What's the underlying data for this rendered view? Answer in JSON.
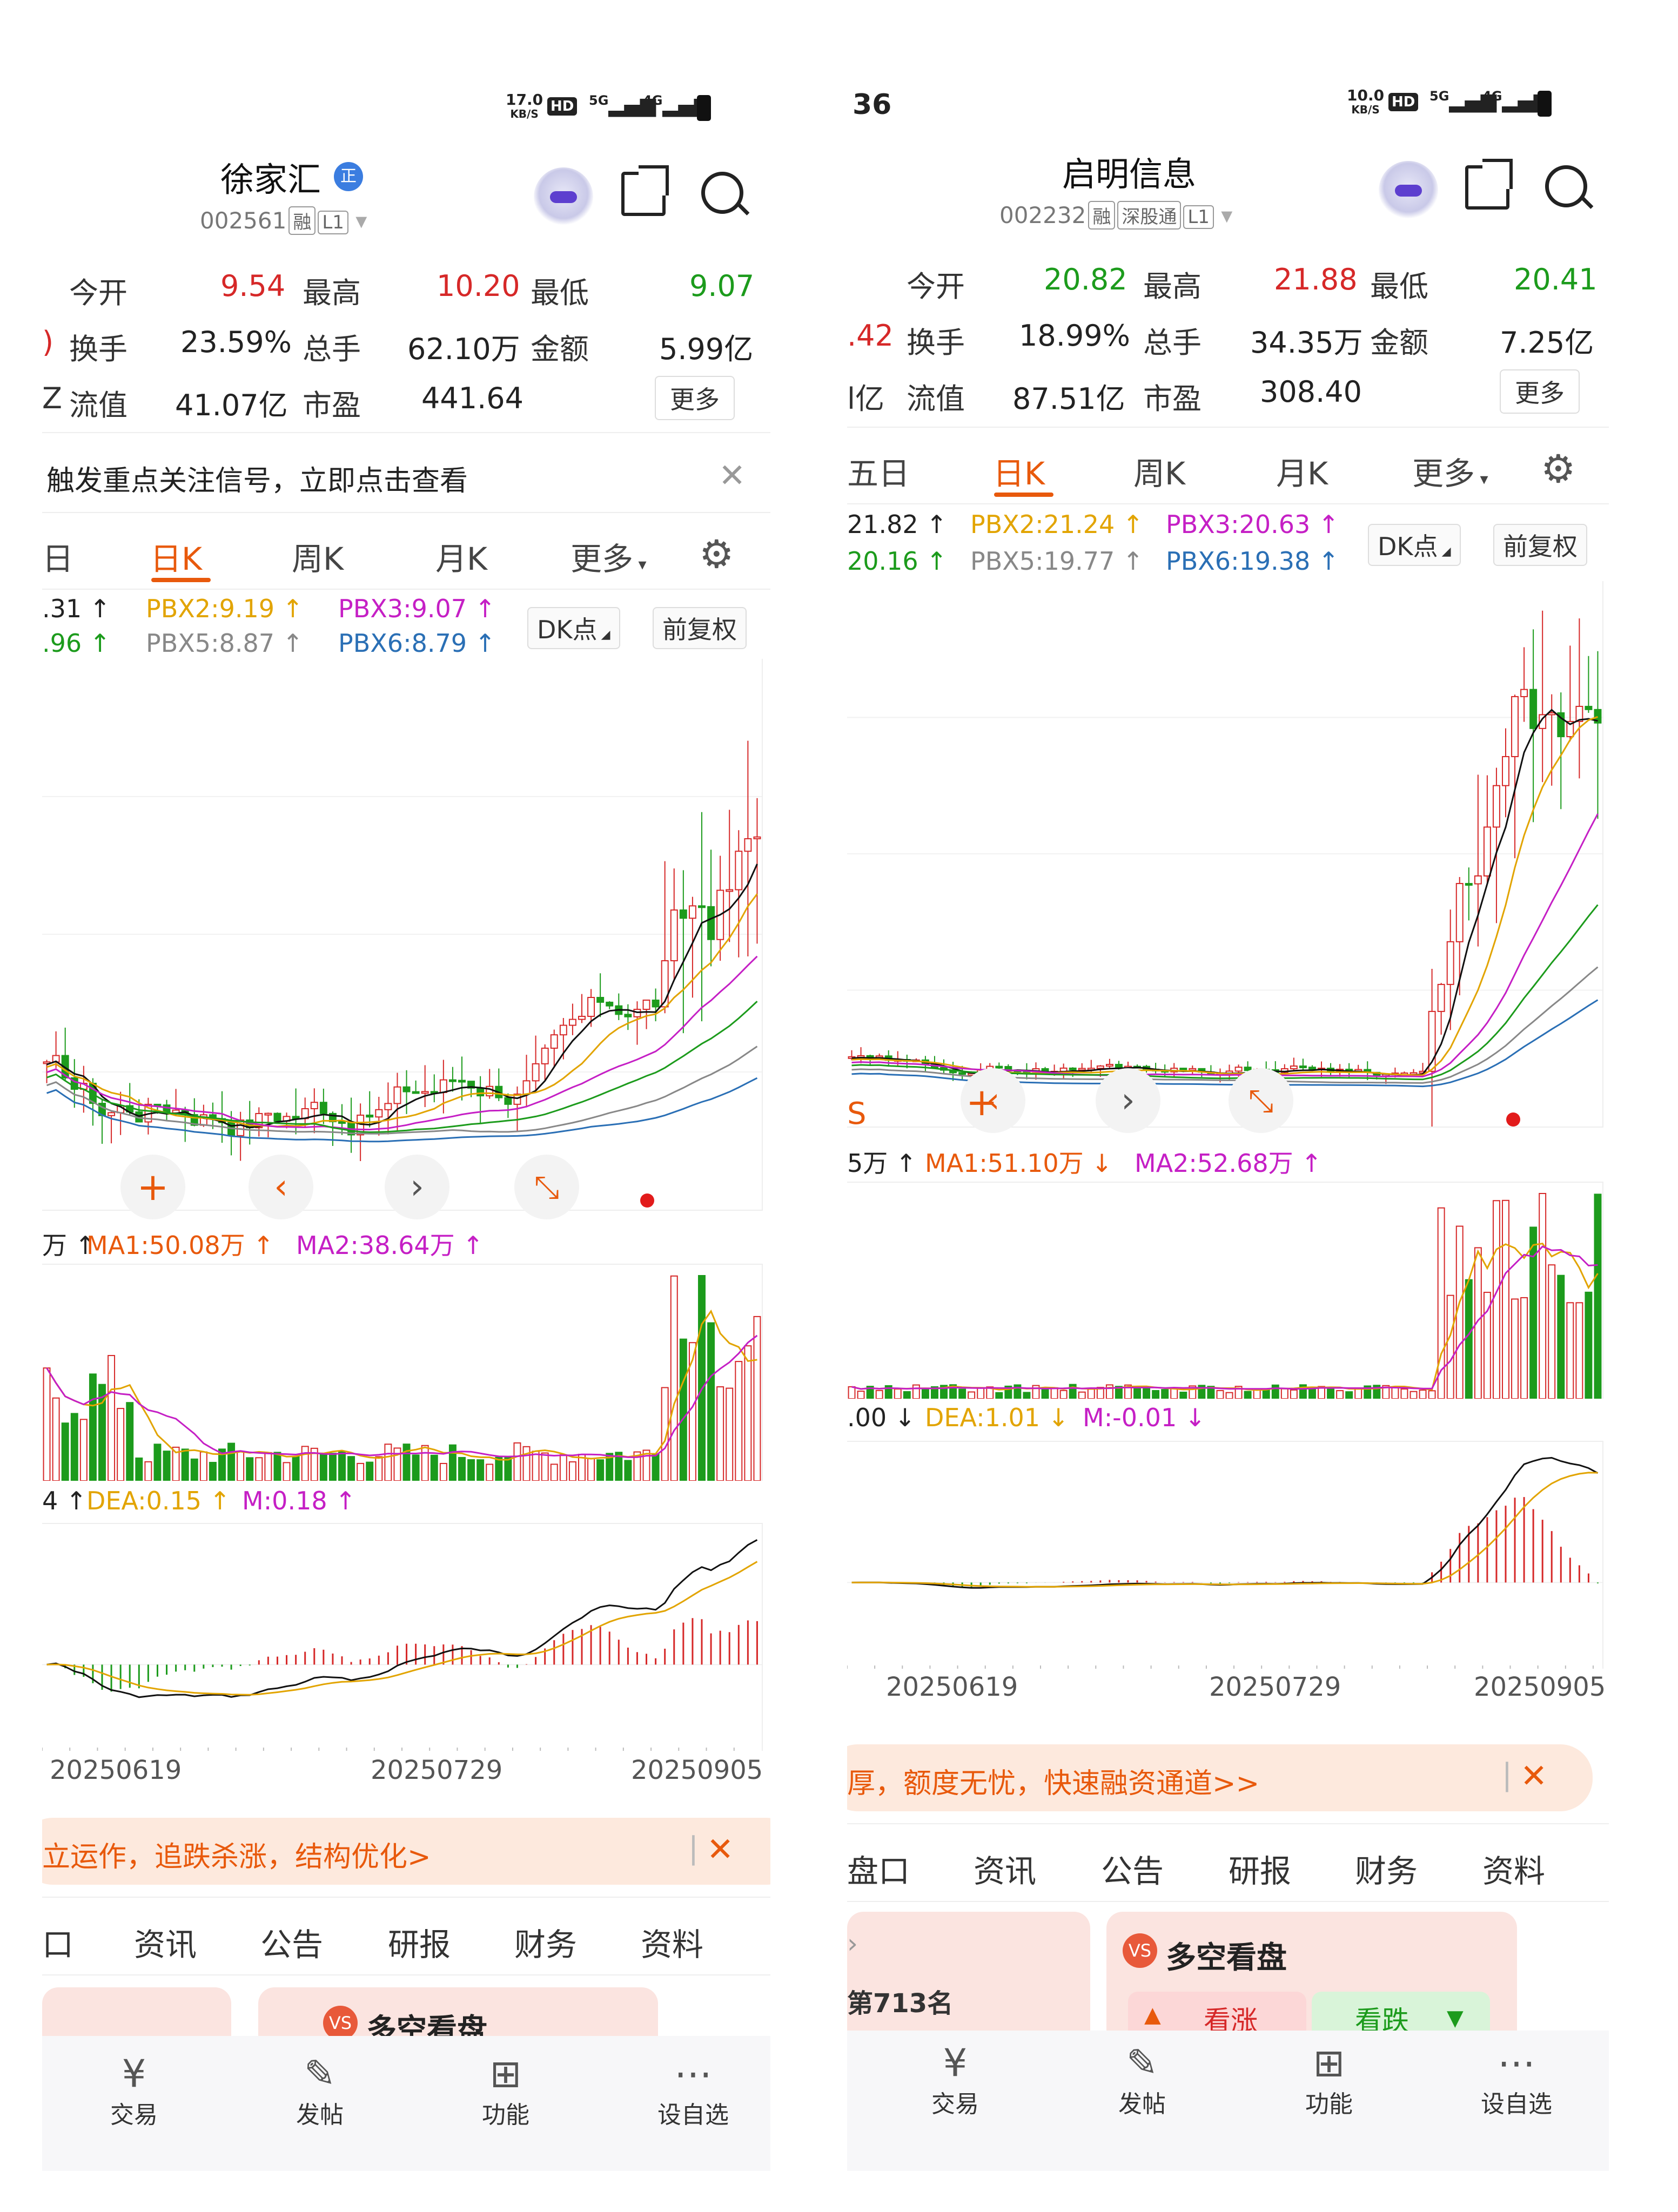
{
  "left": {
    "status": {
      "speed": "17.0",
      "speed_unit": "KB/S",
      "hd": "HD",
      "net1": "5G",
      "net2": "4G"
    },
    "title": "徐家汇",
    "title_badge": "正",
    "code": "002561",
    "code_badges": [
      "融",
      "L1"
    ],
    "quotes": {
      "row1": [
        {
          "label": "今开",
          "value": "9.54"
        },
        {
          "label": "最高",
          "value": "10.20"
        },
        {
          "label": "最低",
          "value": "9.07"
        }
      ],
      "row2": [
        {
          "label": "换手",
          "value": "23.59%"
        },
        {
          "label": "总手",
          "value": "62.10万"
        },
        {
          "label": "金额",
          "value": "5.99亿"
        }
      ],
      "row3": [
        {
          "label": "流值",
          "value": "41.07亿"
        },
        {
          "label": "市盈",
          "value": "441.64"
        }
      ],
      "row2_prefix": ")",
      "row3_prefix": "Z",
      "more": "更多"
    },
    "notice": "触发重点关注信号，立即点击查看",
    "tabs": [
      "日",
      "日K",
      "周K",
      "月K",
      "更多"
    ],
    "active_tab": "日K",
    "indicators": {
      "a1": ".31",
      "a2": ".96",
      "pbx2": "PBX2:9.19",
      "pbx3": "PBX3:9.07",
      "pbx5": "PBX5:8.87",
      "pbx6": "PBX6:8.79"
    },
    "chips": {
      "dk": "DK点",
      "adjust": "前复权"
    },
    "volume_legend": {
      "prefix": "万",
      "ma1": "MA1:50.08万",
      "ma2": "MA2:38.64万"
    },
    "macd_legend": {
      "prefix": "4",
      "dea": "DEA:0.15",
      "m": "M:0.18"
    },
    "dates": [
      "20250619",
      "20250729",
      "20250905"
    ],
    "banner": "立运作，追跌杀涨，结构优化>",
    "bottom_tabs": [
      "口",
      "资讯",
      "公告",
      "研报",
      "财务",
      "资料"
    ],
    "card_title": "多空看盘",
    "nav": [
      "交易",
      "发帖",
      "功能",
      "设自选"
    ]
  },
  "right": {
    "status": {
      "time": "36",
      "speed": "10.0",
      "speed_unit": "KB/S",
      "hd": "HD",
      "net1": "5G",
      "net2": "4G"
    },
    "title": "启明信息",
    "code": "002232",
    "code_badges": [
      "融",
      "深股通",
      "L1"
    ],
    "quotes": {
      "row1": [
        {
          "label": "今开",
          "value": "20.82"
        },
        {
          "label": "最高",
          "value": "21.88"
        },
        {
          "label": "最低",
          "value": "20.41"
        }
      ],
      "row2": [
        {
          "label": "换手",
          "value": "18.99%"
        },
        {
          "label": "总手",
          "value": "34.35万"
        },
        {
          "label": "金额",
          "value": "7.25亿"
        }
      ],
      "row3": [
        {
          "label": "流值",
          "value": "87.51亿"
        },
        {
          "label": "市盈",
          "value": "308.40"
        }
      ],
      "row2_prefix": ".42",
      "row3_prefix": "l亿",
      "more": "更多"
    },
    "tabs": [
      "五日",
      "日K",
      "周K",
      "月K",
      "更多"
    ],
    "active_tab": "日K",
    "indicators": {
      "a1": "21.82",
      "a2": "20.16",
      "pbx2": "PBX2:21.24",
      "pbx3": "PBX3:20.63",
      "pbx5": "PBX5:19.77",
      "pbx6": "PBX6:19.38"
    },
    "chips": {
      "dk": "DK点",
      "adjust": "前复权"
    },
    "volume_legend": {
      "prefix": "5万",
      "ma1": "MA1:51.10万",
      "ma2": "MA2:52.68万"
    },
    "macd_legend": {
      "prefix": ".00",
      "dea": "DEA:1.01",
      "m": "M:-0.01"
    },
    "dates": [
      "20250619",
      "20250729",
      "20250905"
    ],
    "banner": "厚，额度无忧，快速融资通道>>",
    "bottom_tabs": [
      "盘口",
      "资讯",
      "公告",
      "研报",
      "财务",
      "资料"
    ],
    "rank_text": "第713名",
    "card_title": "多空看盘",
    "card_buttons": [
      "看涨",
      "看跌"
    ],
    "nav": [
      "交易",
      "发帖",
      "功能",
      "设自选"
    ]
  },
  "colors": {
    "up": "#d62828",
    "down": "#1c9b1c",
    "accent": "#e8590c",
    "ma_yellow": "#e2a400",
    "ma_magenta": "#c51fc5",
    "ma_blue": "#2a6fb5",
    "ma_gray": "#888888"
  },
  "icons": [
    "robot-avatar-icon",
    "share-icon",
    "search-icon",
    "close-icon",
    "settings-gear-icon",
    "chevron-left-icon",
    "chevron-right-icon",
    "expand-icon",
    "crosshair-icon",
    "trade-icon",
    "post-icon",
    "function-grid-icon",
    "add-watchlist-icon"
  ]
}
